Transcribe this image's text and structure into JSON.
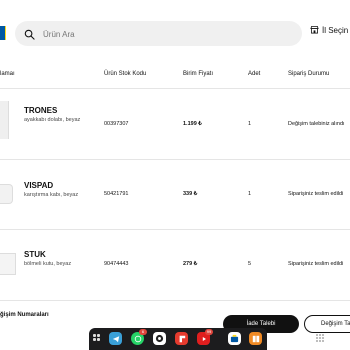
{
  "header": {
    "search_placeholder": "Ürün Ara",
    "store_label": "İl Seçin"
  },
  "table": {
    "columns": {
      "product": "lamaı",
      "sku": "Ürün Stok Kodu",
      "price": "Birim Fiyatı",
      "qty": "Adet",
      "status": "Sipariş Durumu"
    },
    "rows": [
      {
        "name": "TRONES",
        "desc": "ayakkabı dolabı, beyaz",
        "sku": "00397307",
        "price": "1.199 ₺",
        "qty": "1",
        "status": "Değişim talebiniz alındı"
      },
      {
        "name": "VISPAD",
        "desc": "karıştırma kabı, beyaz",
        "sku": "50421791",
        "price": "339 ₺",
        "qty": "1",
        "status": "Siparişiniz teslim edildi"
      },
      {
        "name": "STUK",
        "desc": "bölmeli kutu, beyaz",
        "sku": "90474443",
        "price": "279 ₺",
        "qty": "5",
        "status": "Siparişiniz teslim edildi"
      }
    ]
  },
  "footer": {
    "section_title": "ğişim Numaraları",
    "primary_button": "İade Talebi",
    "secondary_button": "Değişim Ta"
  },
  "taskbar": {
    "badges": {
      "whatsapp": "6",
      "youtube": "99"
    }
  },
  "colors": {
    "brand_blue": "#0058a3",
    "brand_yellow": "#ffda1a",
    "primary_button": "#111111"
  }
}
